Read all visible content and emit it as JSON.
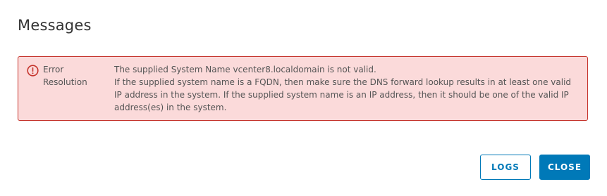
{
  "dialog": {
    "title": "Messages"
  },
  "alert": {
    "type": "error",
    "icon": "error-circle-icon",
    "labels": [
      "Error",
      "Resolution"
    ],
    "error_text": "The supplied System Name vcenter8.localdomain is not valid.",
    "resolution_text": "If the supplied system name is a FQDN, then make sure the DNS forward lookup results in at least one valid IP address in the system. If the supplied system name is an IP address, then it should be one of the valid IP address(es) in the system.",
    "colors": {
      "background": "#fbdada",
      "border": "#c5342c",
      "icon": "#c5342c"
    }
  },
  "footer": {
    "logs_label": "LOGS",
    "close_label": "CLOSE",
    "accent_color": "#0079b8"
  }
}
